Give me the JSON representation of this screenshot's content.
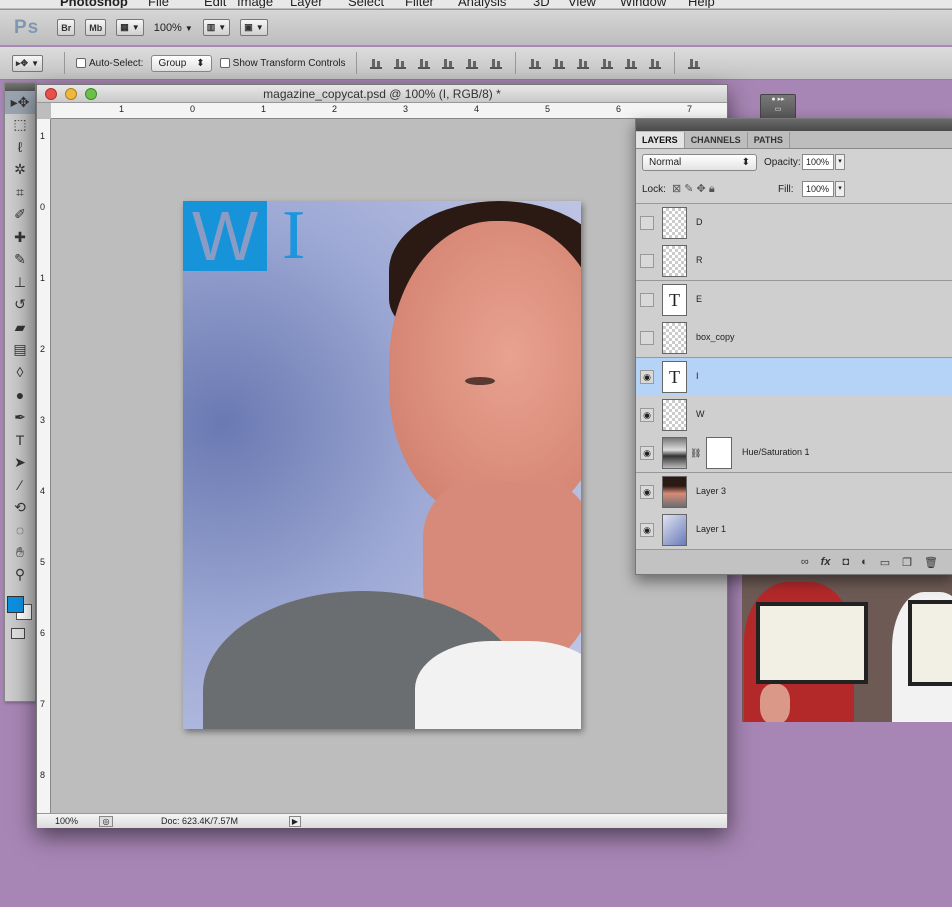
{
  "menubar": {
    "items": [
      "Photoshop",
      "File",
      "Edit",
      "Image",
      "Layer",
      "Select",
      "Filter",
      "Analysis",
      "3D",
      "View",
      "Window",
      "Help"
    ]
  },
  "appbar": {
    "logo": "Ps",
    "bridge": "Br",
    "minibridge": "Mb",
    "zoom": "100%"
  },
  "options": {
    "auto_select_label": "Auto-Select:",
    "auto_select_value": "Group",
    "show_transform_label": "Show Transform Controls"
  },
  "tools": [
    "move-icon",
    "marquee-icon",
    "lasso-icon",
    "quick-select-icon",
    "crop-icon",
    "eyedropper-icon",
    "healing-icon",
    "brush-icon",
    "stamp-icon",
    "history-brush-icon",
    "eraser-icon",
    "gradient-icon",
    "blur-icon",
    "dodge-icon",
    "pen-icon",
    "type-icon",
    "path-select-icon",
    "line-icon",
    "3d-rotate-icon",
    "3d-orbit-icon",
    "hand-icon",
    "zoom-icon"
  ],
  "colors": {
    "foreground": "#0d8fe0",
    "background": "#ffffff",
    "desktop": "#a785b4"
  },
  "document": {
    "title": "magazine_copycat.psd @ 100% (I, RGB/8) *",
    "hruler_labels": [
      "1",
      "0",
      "1",
      "2",
      "3",
      "4",
      "5",
      "6",
      "7"
    ],
    "vruler_labels": [
      "1",
      "0",
      "1",
      "2",
      "3",
      "4",
      "5",
      "6",
      "7",
      "8"
    ],
    "canvas_letter_1": "W",
    "canvas_letter_2": "I",
    "status_zoom": "100%",
    "status_doc": "Doc: 623.4K/7.57M"
  },
  "layers_panel": {
    "tabs": [
      "LAYERS",
      "CHANNELS",
      "PATHS"
    ],
    "blend_mode": "Normal",
    "opacity_label": "Opacity:",
    "opacity": "100%",
    "lock_label": "Lock:",
    "fill_label": "Fill:",
    "fill": "100%",
    "layers": [
      {
        "name": "D",
        "visible": false,
        "thumb": "checker",
        "selected": false
      },
      {
        "name": "R",
        "visible": false,
        "thumb": "checker",
        "selected": false
      },
      {
        "name": "E",
        "visible": false,
        "thumb": "text",
        "selected": false
      },
      {
        "name": "box_copy",
        "visible": false,
        "thumb": "checker",
        "selected": false
      },
      {
        "name": "I",
        "visible": true,
        "thumb": "text",
        "selected": true
      },
      {
        "name": "W",
        "visible": true,
        "thumb": "checker",
        "selected": false
      },
      {
        "name": "Hue/Saturation 1",
        "visible": true,
        "thumb": "hue",
        "selected": false
      },
      {
        "name": "Layer 3",
        "visible": true,
        "thumb": "photo",
        "selected": false
      },
      {
        "name": "Layer 1",
        "visible": true,
        "thumb": "grad",
        "selected": false
      }
    ],
    "text_thumb_glyph": "T",
    "footer_icons": [
      "link-icon",
      "fx-icon",
      "mask-icon",
      "adjustment-icon",
      "group-icon",
      "new-layer-icon",
      "trash-icon"
    ]
  }
}
